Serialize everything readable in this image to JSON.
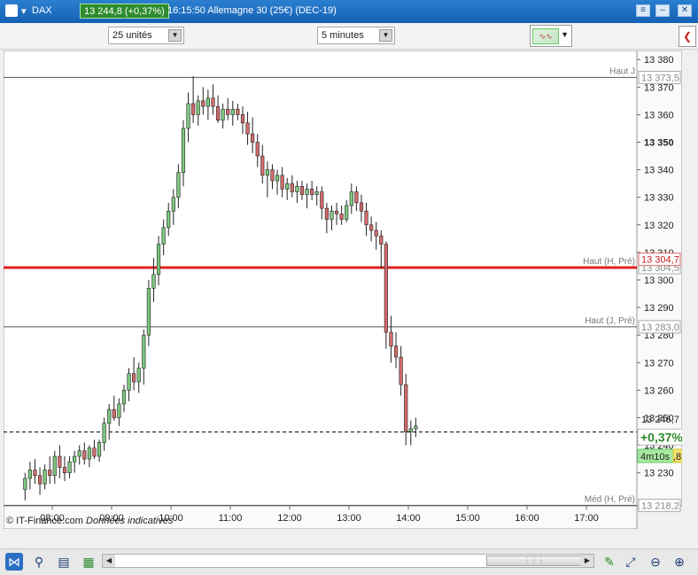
{
  "window": {
    "instrument": "DAX",
    "price_change": "13 244,8 (+0,37%)",
    "title": "16:15:50  Allemagne 30 (25€) (DEC-19)"
  },
  "toolbar": {
    "units_select": "25 unités",
    "interval_select": "5 minutes"
  },
  "footer": {
    "copyright": "© IT-Finance.com",
    "notice": "Données indicatives"
  },
  "chart_data": {
    "type": "candlestick",
    "ylim": [
      13218,
      13382
    ],
    "y_ticks": [
      13380,
      13370,
      13360,
      13350,
      13340,
      13330,
      13320,
      13310,
      13300,
      13290,
      13280,
      13270,
      13260,
      13250,
      13240,
      13230
    ],
    "y_tick_labels": [
      "13 380",
      "13 370",
      "13 360",
      "13 350",
      "13 340",
      "13 330",
      "13 320",
      "13 310",
      "13 300",
      "13 290",
      "13 280",
      "13 270",
      "13 260",
      "13 250",
      "13 240",
      "13 230"
    ],
    "x_tick_labels": [
      "08:00",
      "09:00",
      "10:00",
      "11:00",
      "12:00",
      "13:00",
      "14:00",
      "15:00",
      "16:00",
      "17:00"
    ],
    "x_start": "07:30",
    "candle_minutes": 5,
    "colors": {
      "up": "#7ec87e",
      "down": "#d46b6b",
      "level_red": "#e02020",
      "axis_bg": "#ffffff"
    },
    "levels": [
      {
        "label": "Haut J",
        "value": 13373.5,
        "value_label": "13 373,5",
        "style": "solid-grey"
      },
      {
        "label": "Haut (H, Pré)",
        "value": 13304.5,
        "value_label": "13 304,5",
        "style": "solid-red"
      },
      {
        "label": "Haut (J, Pré)",
        "value": 13283.0,
        "value_label": "13 283,0",
        "style": "solid-grey"
      },
      {
        "label": "Méd (H, Pré)",
        "value": 13218.2,
        "value_label": "13 218,2",
        "style": "solid-grey"
      },
      {
        "label": "",
        "value": 13244.8,
        "value_label": "",
        "style": "dashed-black"
      }
    ],
    "price_labels": {
      "red_tag": "13 304,7",
      "last_price": "13 246,7",
      "change_pct": "+0,37%",
      "timer": "4m10s",
      "timer_suffix": ",8"
    },
    "candles": [
      [
        13224,
        13230,
        13220,
        13228
      ],
      [
        13228,
        13234,
        13224,
        13231
      ],
      [
        13231,
        13235,
        13226,
        13229
      ],
      [
        13229,
        13232,
        13222,
        13226
      ],
      [
        13226,
        13233,
        13224,
        13231
      ],
      [
        13231,
        13236,
        13226,
        13229
      ],
      [
        13229,
        13238,
        13226,
        13236
      ],
      [
        13236,
        13240,
        13228,
        13232
      ],
      [
        13232,
        13236,
        13227,
        13230
      ],
      [
        13230,
        13236,
        13228,
        13234
      ],
      [
        13234,
        13238,
        13230,
        13236
      ],
      [
        13236,
        13240,
        13233,
        13238
      ],
      [
        13238,
        13241,
        13233,
        13235
      ],
      [
        13235,
        13240,
        13232,
        13239
      ],
      [
        13239,
        13242,
        13235,
        13236
      ],
      [
        13236,
        13242,
        13234,
        13241
      ],
      [
        13241,
        13250,
        13238,
        13248
      ],
      [
        13248,
        13255,
        13242,
        13253
      ],
      [
        13253,
        13258,
        13249,
        13250
      ],
      [
        13250,
        13257,
        13247,
        13255
      ],
      [
        13255,
        13262,
        13252,
        13260
      ],
      [
        13260,
        13268,
        13256,
        13266
      ],
      [
        13266,
        13272,
        13260,
        13263
      ],
      [
        13263,
        13270,
        13259,
        13268
      ],
      [
        13268,
        13282,
        13262,
        13280
      ],
      [
        13280,
        13300,
        13276,
        13297
      ],
      [
        13297,
        13308,
        13292,
        13302
      ],
      [
        13302,
        13316,
        13298,
        13313
      ],
      [
        13313,
        13322,
        13309,
        13319
      ],
      [
        13319,
        13328,
        13316,
        13325
      ],
      [
        13325,
        13333,
        13320,
        13330
      ],
      [
        13330,
        13342,
        13326,
        13339
      ],
      [
        13339,
        13358,
        13334,
        13355
      ],
      [
        13355,
        13368,
        13350,
        13364
      ],
      [
        13364,
        13374,
        13357,
        13360
      ],
      [
        13360,
        13367,
        13356,
        13365
      ],
      [
        13365,
        13370,
        13360,
        13363
      ],
      [
        13363,
        13369,
        13358,
        13366
      ],
      [
        13366,
        13371,
        13360,
        13363
      ],
      [
        13363,
        13367,
        13357,
        13358
      ],
      [
        13358,
        13364,
        13355,
        13362
      ],
      [
        13362,
        13366,
        13358,
        13360
      ],
      [
        13360,
        13365,
        13356,
        13362
      ],
      [
        13362,
        13364,
        13358,
        13360
      ],
      [
        13360,
        13363,
        13353,
        13357
      ],
      [
        13357,
        13361,
        13349,
        13353
      ],
      [
        13353,
        13359,
        13346,
        13350
      ],
      [
        13350,
        13353,
        13341,
        13345
      ],
      [
        13345,
        13349,
        13335,
        13338
      ],
      [
        13338,
        13343,
        13330,
        13340
      ],
      [
        13340,
        13342,
        13333,
        13336
      ],
      [
        13336,
        13340,
        13331,
        13338
      ],
      [
        13338,
        13341,
        13330,
        13333
      ],
      [
        13333,
        13337,
        13329,
        13335
      ],
      [
        13335,
        13338,
        13330,
        13332
      ],
      [
        13332,
        13336,
        13328,
        13334
      ],
      [
        13334,
        13336,
        13329,
        13331
      ],
      [
        13331,
        13335,
        13326,
        13333
      ],
      [
        13333,
        13336,
        13329,
        13331
      ],
      [
        13331,
        13334,
        13327,
        13332
      ],
      [
        13332,
        13334,
        13322,
        13326
      ],
      [
        13326,
        13328,
        13317,
        13322
      ],
      [
        13322,
        13327,
        13318,
        13325
      ],
      [
        13325,
        13328,
        13320,
        13324
      ],
      [
        13324,
        13327,
        13320,
        13322
      ],
      [
        13322,
        13329,
        13321,
        13327
      ],
      [
        13327,
        13335,
        13324,
        13332
      ],
      [
        13332,
        13334,
        13325,
        13328
      ],
      [
        13328,
        13331,
        13321,
        13325
      ],
      [
        13325,
        13328,
        13316,
        13320
      ],
      [
        13320,
        13323,
        13314,
        13318
      ],
      [
        13318,
        13321,
        13311,
        13316
      ],
      [
        13316,
        13318,
        13304,
        13313
      ],
      [
        13313,
        13314,
        13275,
        13281
      ],
      [
        13281,
        13287,
        13270,
        13276
      ],
      [
        13276,
        13281,
        13268,
        13272
      ],
      [
        13272,
        13276,
        13258,
        13262
      ],
      [
        13262,
        13266,
        13240,
        13245
      ],
      [
        13245,
        13249,
        13240,
        13246
      ],
      [
        13246,
        13250,
        13243,
        13247
      ]
    ]
  }
}
